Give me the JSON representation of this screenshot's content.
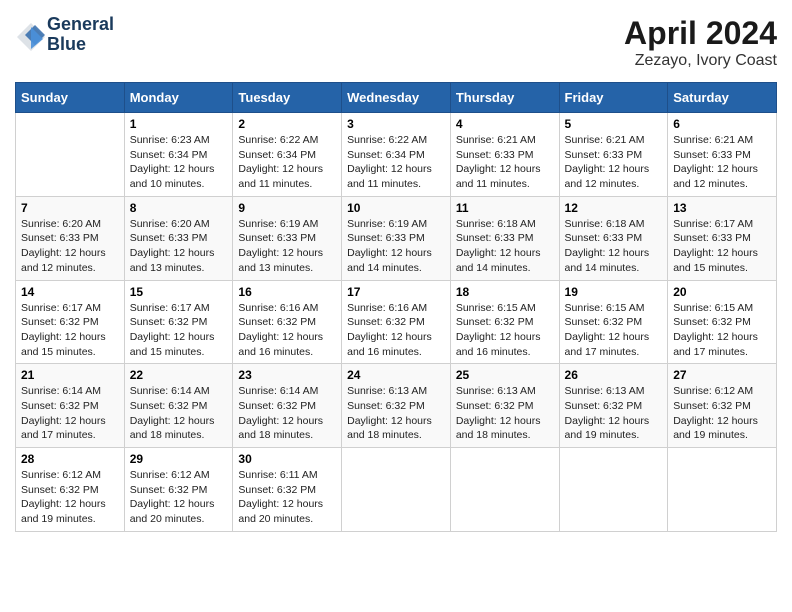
{
  "logo": {
    "line1": "General",
    "line2": "Blue"
  },
  "title": "April 2024",
  "subtitle": "Zezayo, Ivory Coast",
  "days_of_week": [
    "Sunday",
    "Monday",
    "Tuesday",
    "Wednesday",
    "Thursday",
    "Friday",
    "Saturday"
  ],
  "weeks": [
    [
      {
        "day": "",
        "content": ""
      },
      {
        "day": "1",
        "content": "Sunrise: 6:23 AM\nSunset: 6:34 PM\nDaylight: 12 hours\nand 10 minutes."
      },
      {
        "day": "2",
        "content": "Sunrise: 6:22 AM\nSunset: 6:34 PM\nDaylight: 12 hours\nand 11 minutes."
      },
      {
        "day": "3",
        "content": "Sunrise: 6:22 AM\nSunset: 6:34 PM\nDaylight: 12 hours\nand 11 minutes."
      },
      {
        "day": "4",
        "content": "Sunrise: 6:21 AM\nSunset: 6:33 PM\nDaylight: 12 hours\nand 11 minutes."
      },
      {
        "day": "5",
        "content": "Sunrise: 6:21 AM\nSunset: 6:33 PM\nDaylight: 12 hours\nand 12 minutes."
      },
      {
        "day": "6",
        "content": "Sunrise: 6:21 AM\nSunset: 6:33 PM\nDaylight: 12 hours\nand 12 minutes."
      }
    ],
    [
      {
        "day": "7",
        "content": "Sunrise: 6:20 AM\nSunset: 6:33 PM\nDaylight: 12 hours\nand 12 minutes."
      },
      {
        "day": "8",
        "content": "Sunrise: 6:20 AM\nSunset: 6:33 PM\nDaylight: 12 hours\nand 13 minutes."
      },
      {
        "day": "9",
        "content": "Sunrise: 6:19 AM\nSunset: 6:33 PM\nDaylight: 12 hours\nand 13 minutes."
      },
      {
        "day": "10",
        "content": "Sunrise: 6:19 AM\nSunset: 6:33 PM\nDaylight: 12 hours\nand 14 minutes."
      },
      {
        "day": "11",
        "content": "Sunrise: 6:18 AM\nSunset: 6:33 PM\nDaylight: 12 hours\nand 14 minutes."
      },
      {
        "day": "12",
        "content": "Sunrise: 6:18 AM\nSunset: 6:33 PM\nDaylight: 12 hours\nand 14 minutes."
      },
      {
        "day": "13",
        "content": "Sunrise: 6:17 AM\nSunset: 6:33 PM\nDaylight: 12 hours\nand 15 minutes."
      }
    ],
    [
      {
        "day": "14",
        "content": "Sunrise: 6:17 AM\nSunset: 6:32 PM\nDaylight: 12 hours\nand 15 minutes."
      },
      {
        "day": "15",
        "content": "Sunrise: 6:17 AM\nSunset: 6:32 PM\nDaylight: 12 hours\nand 15 minutes."
      },
      {
        "day": "16",
        "content": "Sunrise: 6:16 AM\nSunset: 6:32 PM\nDaylight: 12 hours\nand 16 minutes."
      },
      {
        "day": "17",
        "content": "Sunrise: 6:16 AM\nSunset: 6:32 PM\nDaylight: 12 hours\nand 16 minutes."
      },
      {
        "day": "18",
        "content": "Sunrise: 6:15 AM\nSunset: 6:32 PM\nDaylight: 12 hours\nand 16 minutes."
      },
      {
        "day": "19",
        "content": "Sunrise: 6:15 AM\nSunset: 6:32 PM\nDaylight: 12 hours\nand 17 minutes."
      },
      {
        "day": "20",
        "content": "Sunrise: 6:15 AM\nSunset: 6:32 PM\nDaylight: 12 hours\nand 17 minutes."
      }
    ],
    [
      {
        "day": "21",
        "content": "Sunrise: 6:14 AM\nSunset: 6:32 PM\nDaylight: 12 hours\nand 17 minutes."
      },
      {
        "day": "22",
        "content": "Sunrise: 6:14 AM\nSunset: 6:32 PM\nDaylight: 12 hours\nand 18 minutes."
      },
      {
        "day": "23",
        "content": "Sunrise: 6:14 AM\nSunset: 6:32 PM\nDaylight: 12 hours\nand 18 minutes."
      },
      {
        "day": "24",
        "content": "Sunrise: 6:13 AM\nSunset: 6:32 PM\nDaylight: 12 hours\nand 18 minutes."
      },
      {
        "day": "25",
        "content": "Sunrise: 6:13 AM\nSunset: 6:32 PM\nDaylight: 12 hours\nand 18 minutes."
      },
      {
        "day": "26",
        "content": "Sunrise: 6:13 AM\nSunset: 6:32 PM\nDaylight: 12 hours\nand 19 minutes."
      },
      {
        "day": "27",
        "content": "Sunrise: 6:12 AM\nSunset: 6:32 PM\nDaylight: 12 hours\nand 19 minutes."
      }
    ],
    [
      {
        "day": "28",
        "content": "Sunrise: 6:12 AM\nSunset: 6:32 PM\nDaylight: 12 hours\nand 19 minutes."
      },
      {
        "day": "29",
        "content": "Sunrise: 6:12 AM\nSunset: 6:32 PM\nDaylight: 12 hours\nand 20 minutes."
      },
      {
        "day": "30",
        "content": "Sunrise: 6:11 AM\nSunset: 6:32 PM\nDaylight: 12 hours\nand 20 minutes."
      },
      {
        "day": "",
        "content": ""
      },
      {
        "day": "",
        "content": ""
      },
      {
        "day": "",
        "content": ""
      },
      {
        "day": "",
        "content": ""
      }
    ]
  ]
}
